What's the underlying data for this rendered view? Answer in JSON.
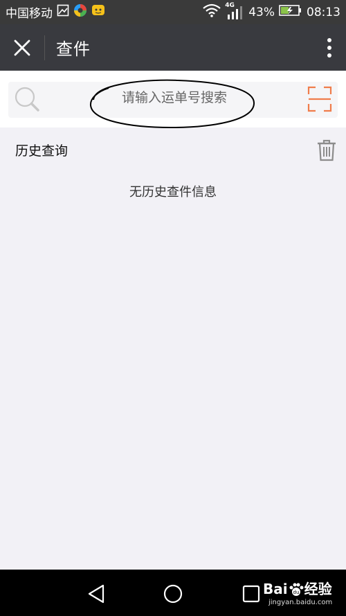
{
  "status_bar": {
    "carrier": "中国移动",
    "network": "4G",
    "battery": "43%",
    "time": "08:13"
  },
  "header": {
    "title": "查件"
  },
  "search": {
    "placeholder": "请输入运单号搜索"
  },
  "history": {
    "title": "历史查询",
    "empty_message": "无历史查件信息"
  },
  "watermark": {
    "brand": "Bai",
    "brand_cn": "经验",
    "url": "jingyan.baidu.com"
  },
  "colors": {
    "title_bar": "#393a3f",
    "accent": "#f07c4a",
    "background": "#f2f1f6"
  },
  "icons": [
    "close-icon",
    "more-vertical-icon",
    "search-icon",
    "scan-icon",
    "trash-icon",
    "back-icon",
    "home-icon",
    "recents-icon"
  ]
}
